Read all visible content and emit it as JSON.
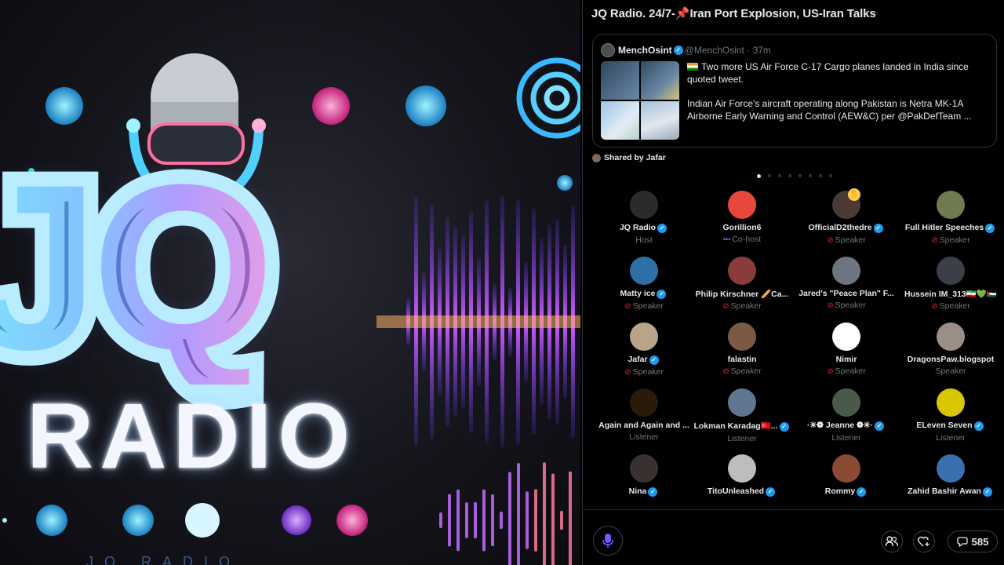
{
  "artwork": {
    "logo_main": "JQ",
    "logo_radio": "RADIO",
    "logo_subtitle": "JQ RADIO"
  },
  "space": {
    "title_prefix": "JQ Radio. 24/7-",
    "title_pin": "📌",
    "title_suffix": "Iran Port Explosion, US-Iran Talks"
  },
  "pinned_tweet": {
    "author_name": "MenchOsint",
    "author_handle": "@MenchOsint",
    "time": "· 37m",
    "paragraph_1": "Two more US Air Force C-17 Cargo planes landed in India since quoted tweet.",
    "paragraph_2": "Indian Air Force's aircraft operating along Pakistan is Netra MK-1A Airborne Early Warning and Control (AEW&C) per @PakDefTeam  ..."
  },
  "shared_by": "Shared by Jafar",
  "participants": [
    {
      "name": "JQ Radio",
      "verified": true,
      "role": "Host",
      "role_icon": "",
      "avatar_color": "#2b2b2b"
    },
    {
      "name": "Gorillion6",
      "verified": false,
      "role": "Co-host",
      "role_icon": "cohost",
      "avatar_color": "#e8473b"
    },
    {
      "name": "OfficialD2thedre",
      "verified": true,
      "role": "Speaker",
      "role_icon": "mute",
      "avatar_color": "#4a3a33",
      "hand_raised": true
    },
    {
      "name": "Full Hitler Speeches",
      "verified": true,
      "role": "Speaker",
      "role_icon": "mute",
      "avatar_color": "#6f7a4f"
    },
    {
      "name": "Matty ice",
      "verified": true,
      "role": "Speaker",
      "role_icon": "mute",
      "avatar_color": "#2f6fa8"
    },
    {
      "name": "Philip Kirschner 🥖Ca...",
      "verified": false,
      "role": "Speaker",
      "role_icon": "mute",
      "avatar_color": "#8a3b3b"
    },
    {
      "name": "Jared's \"Peace Plan\" F...",
      "verified": false,
      "role": "Speaker",
      "role_icon": "mute",
      "avatar_color": "#6d7580"
    },
    {
      "name": "Hussein IM_313🇮🇷💚🇵🇸",
      "verified": false,
      "role": "Speaker",
      "role_icon": "mute",
      "avatar_color": "#3b3f4a"
    },
    {
      "name": "Jafar",
      "verified": true,
      "role": "Speaker",
      "role_icon": "mute",
      "avatar_color": "#b9a48a"
    },
    {
      "name": "falastin",
      "verified": false,
      "role": "Speaker",
      "role_icon": "mute",
      "avatar_color": "#7a5a42"
    },
    {
      "name": "Nimir",
      "verified": false,
      "role": "Speaker",
      "role_icon": "mute",
      "avatar_color": "#ffffff"
    },
    {
      "name": "DragonsPaw.blogspot",
      "verified": false,
      "role": "Speaker",
      "role_icon": "",
      "avatar_color": "#9a8e86"
    },
    {
      "name": "Again and Again and ...",
      "verified": false,
      "role": "Listener",
      "role_icon": "",
      "avatar_color": "#2b1a0a"
    },
    {
      "name": "Lokman Karadag🇹🇷...",
      "verified": true,
      "role": "Listener",
      "role_icon": "",
      "avatar_color": "#5f7690"
    },
    {
      "name": "·✳︎❁ Jeanne ❁✳︎·",
      "verified": true,
      "role": "Listener",
      "role_icon": "",
      "avatar_color": "#4a5a4a"
    },
    {
      "name": "ELeven Seven",
      "verified": true,
      "role": "Listener",
      "role_icon": "",
      "avatar_color": "#d8c600"
    },
    {
      "name": "Nina",
      "verified": true,
      "role": "",
      "role_icon": "",
      "avatar_color": "#3a3030"
    },
    {
      "name": "TitoUnleashed",
      "verified": true,
      "role": "",
      "role_icon": "",
      "avatar_color": "#bdbdbd"
    },
    {
      "name": "Rommy",
      "verified": true,
      "role": "",
      "role_icon": "",
      "avatar_color": "#8a4a33"
    },
    {
      "name": "Zahid Bashir Awan",
      "verified": true,
      "role": "",
      "role_icon": "",
      "avatar_color": "#3b6fae"
    }
  ],
  "controls": {
    "mic_icon": "microphone-icon",
    "people_icon": "people-icon",
    "react_icon": "heart-plus-icon",
    "comment_icon": "comment-icon",
    "comment_count": "585"
  },
  "pager": {
    "pages": 8,
    "active": 0
  },
  "colors": {
    "accent": "#1d9bf0",
    "mute": "#f4212e",
    "mic": "#7856ff",
    "background": "#000000"
  }
}
